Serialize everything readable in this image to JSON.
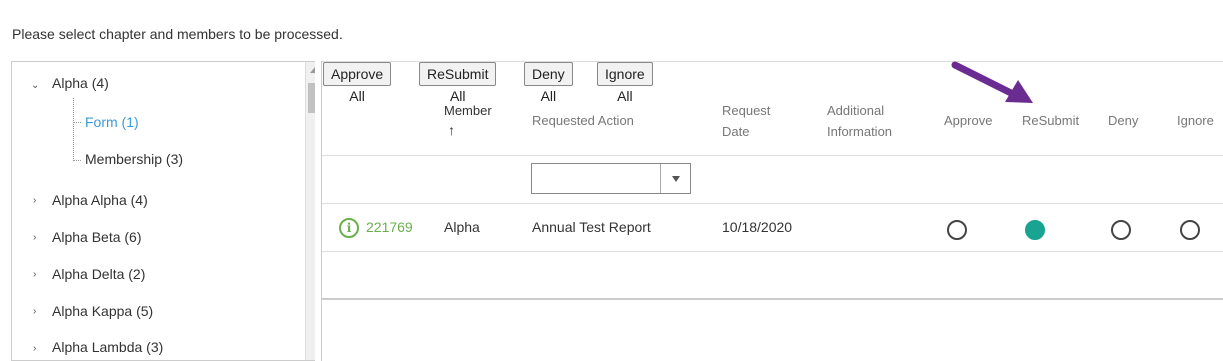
{
  "instruction": "Please select chapter and members to be processed.",
  "tree": {
    "items": [
      {
        "label": "Alpha (4)"
      },
      {
        "label": "Form (1)"
      },
      {
        "label": "Membership (3)"
      },
      {
        "label": "Alpha Alpha (4)"
      },
      {
        "label": "Alpha Beta (6)"
      },
      {
        "label": "Alpha Delta (2)"
      },
      {
        "label": "Alpha Kappa (5)"
      },
      {
        "label": "Alpha Lambda (3)"
      }
    ],
    "selected_color": "#3b9bd8"
  },
  "toolbar": {
    "approve_all": "Approve All",
    "resubmit_all": "ReSubmit All",
    "deny_all": "Deny All",
    "ignore_all": "Ignore All"
  },
  "grid": {
    "headers": {
      "member": "Member",
      "requested_action": "Requested Action",
      "request_line1": "Request",
      "request_line2": "Date",
      "additional_line1": "Additional",
      "additional_line2": "Information",
      "approve": "Approve",
      "resubmit": "ReSubmit",
      "deny": "Deny",
      "ignore": "Ignore"
    },
    "sort_icon": "up-arrow",
    "filter_value": "",
    "row": {
      "id": "221769",
      "member": "Alpha",
      "requested_action": "Annual Test Report",
      "request_date": "10/18/2020",
      "additional_information": "",
      "selected_action": "ReSubmit"
    }
  },
  "colors": {
    "link_green": "#6ab04c",
    "radio_selected": "#19a391",
    "annotation_arrow": "#6a2c91"
  }
}
